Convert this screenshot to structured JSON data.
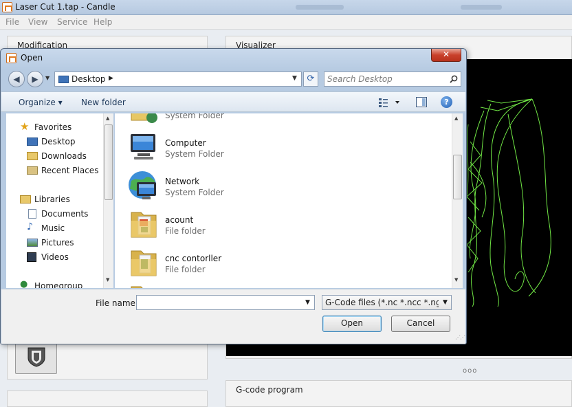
{
  "app": {
    "title": "Laser Cut 1.tap - Candle",
    "menu": [
      "File",
      "View",
      "Service",
      "Help"
    ],
    "panels": {
      "modification": "Modification",
      "visualizer": "Visualizer",
      "gcode_program": "G-code program"
    },
    "visualizer_dots": "ooo",
    "plot_color": "#7dff4d"
  },
  "dialog": {
    "title": "Open",
    "close_label": "✕",
    "address": "Desktop",
    "search_placeholder": "Search Desktop",
    "toolbar": {
      "organize": "Organize ▾",
      "new_folder": "New folder",
      "help_glyph": "?"
    },
    "nav": {
      "favorites": {
        "label": "Favorites",
        "items": [
          "Desktop",
          "Downloads",
          "Recent Places"
        ]
      },
      "libraries": {
        "label": "Libraries",
        "items": [
          "Documents",
          "Music",
          "Pictures",
          "Videos"
        ]
      },
      "homegroup": "Homegroup"
    },
    "files": [
      {
        "name": "",
        "type": "System Folder",
        "icon": "partial-folder-icon"
      },
      {
        "name": "Computer",
        "type": "System Folder",
        "icon": "computer-icon"
      },
      {
        "name": "Network",
        "type": "System Folder",
        "icon": "network-icon"
      },
      {
        "name": "acount",
        "type": "File folder",
        "icon": "folder-icon"
      },
      {
        "name": "cnc contorller",
        "type": "File folder",
        "icon": "folder-icon"
      }
    ],
    "file_name_label": "File name:",
    "file_name_value": "",
    "filter": "G-Code files (*.nc *.ncc *.ngc *.tap *.txt)",
    "open_button": "Open",
    "cancel_button": "Cancel"
  }
}
